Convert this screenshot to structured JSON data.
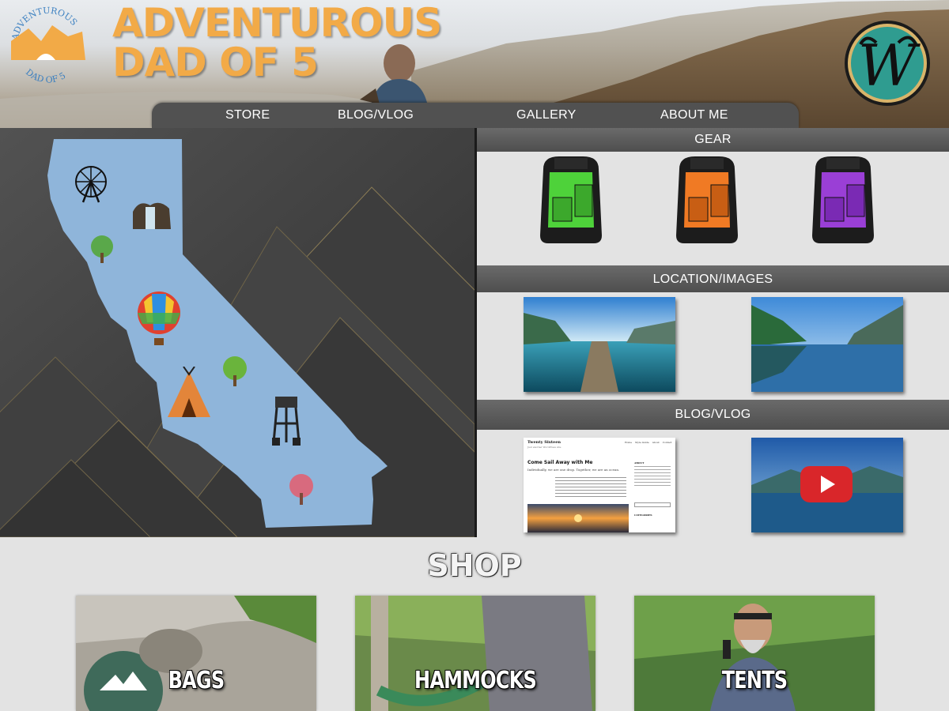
{
  "header": {
    "logo_text_top": "ADVENTUROUS",
    "logo_text_bottom": "DAD OF 5",
    "title_line1": "ADVENTUROUS",
    "title_line2": "DAD OF 5",
    "badge_letter": "W",
    "title_color": "#f2aa47"
  },
  "nav": {
    "items": [
      {
        "label": "STORE"
      },
      {
        "label": "BLOG/VLOG"
      },
      {
        "label": "GALLERY"
      },
      {
        "label": "ABOUT ME"
      }
    ]
  },
  "map": {
    "icons": [
      "ferris-wheel-icon",
      "waterfall-icon",
      "tree-icon",
      "hot-air-balloon-icon",
      "tree-icon",
      "teepee-icon",
      "water-tower-icon",
      "blossom-tree-icon"
    ]
  },
  "sections": {
    "gear": {
      "title": "GEAR",
      "items": [
        {
          "icon": "backpack-icon",
          "color": "#4ed23a"
        },
        {
          "icon": "backpack-icon",
          "color": "#f07a24"
        },
        {
          "icon": "backpack-icon",
          "color": "#9a3fd6"
        }
      ]
    },
    "location": {
      "title": "LOCATION/IMAGES"
    },
    "blog": {
      "title": "BLOG/VLOG",
      "post": {
        "site_name": "Twenty Sixteen",
        "tagline": "Just another WordPress site",
        "menu": [
          "Home",
          "Style Guide",
          "About",
          "Contact"
        ],
        "heading": "Come Sail Away with Me",
        "excerpt": "Individually, we are one drop. Together, we are an ocean.",
        "sidebar_title": "ABOUT",
        "categories_title": "CATEGORIES"
      }
    }
  },
  "shop": {
    "title": "SHOP",
    "cards": [
      {
        "label": "BAGS"
      },
      {
        "label": "HAMMOCKS"
      },
      {
        "label": "TENTS"
      }
    ]
  }
}
